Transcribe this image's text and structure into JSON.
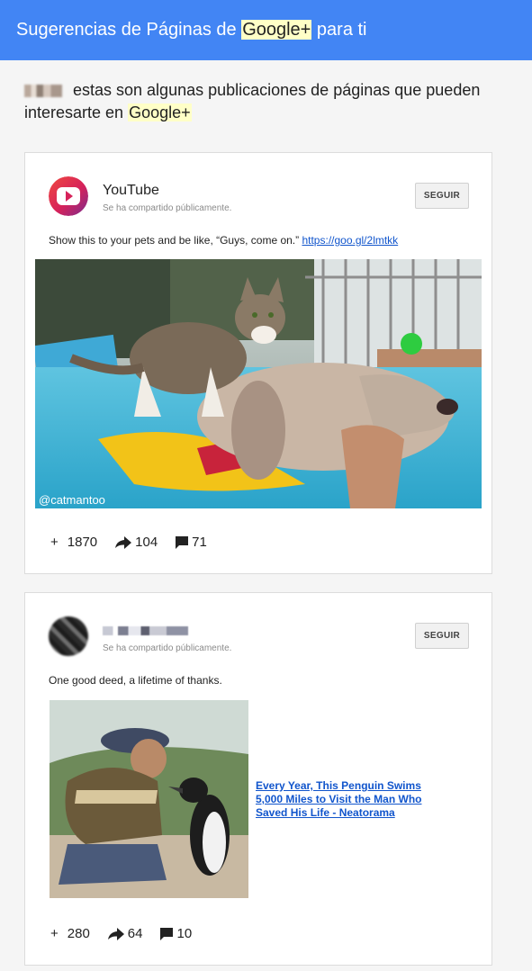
{
  "header": {
    "title_before": "Sugerencias de Páginas de ",
    "title_highlight": "Google+",
    "title_after": " para ti"
  },
  "intro": {
    "text": "estas son algunas publicaciones de páginas que pueden interesarte en ",
    "highlight": "Google+"
  },
  "posts": [
    {
      "author": "YouTube",
      "shared_label": "Se ha compartido públicamente.",
      "follow_label": "SEGUIR",
      "text": "Show this to your pets and be like, “Guys, come on.” ",
      "link": "https://goo.gl/2lmtkk",
      "watermark": "@catmantoo",
      "plus_count": "1870",
      "share_count": "104",
      "comment_count": "71",
      "plus_glyph": "+"
    },
    {
      "author": "",
      "shared_label": "Se ha compartido públicamente.",
      "follow_label": "SEGUIR",
      "text": "One good deed, a lifetime of thanks.",
      "link_title": "Every Year, This Penguin Swims 5,000 Miles to Visit the Man Who Saved His Life - Neatorama",
      "plus_count": "280",
      "share_count": "64",
      "comment_count": "10",
      "plus_glyph": "+"
    }
  ],
  "colors": {
    "header": "#4285f4",
    "highlight": "#ffffc7",
    "link": "#1155cc",
    "youtube_red": "#e52d27"
  },
  "icons": [
    "youtube-logo-icon",
    "share-arrow-icon",
    "comment-icon",
    "plus-icon"
  ]
}
